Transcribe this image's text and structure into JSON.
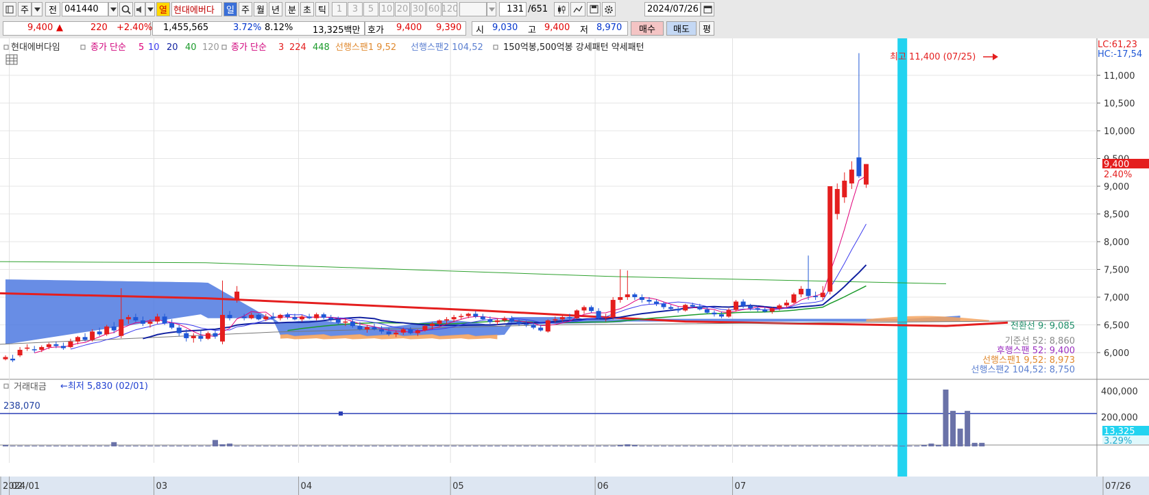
{
  "toolbar": {
    "market": "주",
    "prev_label": "전",
    "code": "041440",
    "sound_label": "열",
    "stock_name": "현대에버다",
    "periods": [
      "일",
      "주",
      "월",
      "년",
      "분",
      "초",
      "틱"
    ],
    "active_period": "일",
    "intervals": [
      "1",
      "3",
      "5",
      "10",
      "20",
      "30",
      "60",
      "120"
    ],
    "count": "131",
    "count_total": "/651",
    "date": "2024/07/26"
  },
  "quote": {
    "price": "9,400",
    "arrow": "▲",
    "change": "220",
    "change_pct": "+2.40%",
    "volume": "1,455,565",
    "turnover_pct": "3.72%",
    "rate2": "8.12%",
    "amount": "13,325백만",
    "hoga_label": "호가",
    "ask": "9,400",
    "bid": "9,390",
    "open_label": "시",
    "open": "9,030",
    "high_label": "고",
    "high": "9,400",
    "low_label": "저",
    "low": "8,970",
    "buy_label": "매수",
    "sell_label": "매도",
    "eval_label": "평"
  },
  "colors": {
    "up": "#e41e1e",
    "down": "#1f57d6",
    "ma5": "#e0007a",
    "ma10": "#3a3aee",
    "ma20": "#1020a0",
    "ma40": "#1a9a2a",
    "ma120": "#2ca02c",
    "ma3": "#e41e1e",
    "cloud_blue": "#4d79e0",
    "cloud_orange": "#f4a460",
    "highlight": "#22d3f0"
  },
  "legend": {
    "stock": "현대에버다임",
    "ma_label": "종가 단순",
    "ma_periods": [
      "5",
      "10",
      "20",
      "40",
      "120"
    ],
    "ma2_label": "종가 단순",
    "ma2_periods": [
      "3",
      "224",
      "448"
    ],
    "span1": "선행스팬1 9,52",
    "span2": "선행스팬2 104,52",
    "extra": "150억봉,500억봉 강세패턴  약세패턴"
  },
  "annotations": {
    "high": "최고 11,400 (07/25)",
    "low": "←최저 5,830 (02/01)",
    "lc": "LC:61,23",
    "hc": "HC:-17,54",
    "price_tag": "9,400",
    "pct_tag": "2.40%",
    "vol_tag": "13,325",
    "vol_pct_tag": "3.29%"
  },
  "ichimoku_labels": [
    {
      "text": "전환선 9: 9,085",
      "color": "#1f8f6a"
    },
    {
      "text": "기준선 52: 8,860",
      "color": "#8a8a8a"
    },
    {
      "text": "후행스팬 52: 9,400",
      "color": "#9b30c0"
    },
    {
      "text": "선행스팬1 9,52: 8,973",
      "color": "#e08a30"
    },
    {
      "text": "선행스팬2 104,52: 8,750",
      "color": "#5b7fd0"
    }
  ],
  "volume_panel": {
    "title": "거래대금",
    "ref_value": "238,070"
  },
  "chart_data": {
    "type": "candlestick",
    "title": "현대에버다임",
    "y_ticks": [
      6000,
      6500,
      7000,
      7500,
      8000,
      8500,
      9000,
      9500,
      10000,
      10500,
      11000
    ],
    "y_tick_labels": [
      "6,000",
      "6,500",
      "7,000",
      "7,500",
      "8,000",
      "8,500",
      "9,000",
      "9,500",
      "10,000",
      "10,500",
      "11,000"
    ],
    "ylim": [
      5550,
      11700
    ],
    "x_labels": [
      "2024/01",
      "02",
      "03",
      "04",
      "05",
      "06",
      "07",
      "07/26"
    ],
    "month_start_index": {
      "02": 1,
      "03": 21,
      "04": 41,
      "05": 62,
      "06": 82,
      "07": 101
    },
    "candles": [
      {
        "o": 5880,
        "h": 5950,
        "l": 5860,
        "c": 5920
      },
      {
        "o": 5890,
        "h": 5960,
        "l": 5830,
        "c": 5860
      },
      {
        "o": 5950,
        "h": 6100,
        "l": 5920,
        "c": 6050
      },
      {
        "o": 6070,
        "h": 6150,
        "l": 6030,
        "c": 6090
      },
      {
        "o": 6060,
        "h": 6120,
        "l": 6000,
        "c": 6050
      },
      {
        "o": 6050,
        "h": 6130,
        "l": 6010,
        "c": 6100
      },
      {
        "o": 6100,
        "h": 6180,
        "l": 6060,
        "c": 6150
      },
      {
        "o": 6150,
        "h": 6200,
        "l": 6080,
        "c": 6120
      },
      {
        "o": 6120,
        "h": 6180,
        "l": 6050,
        "c": 6080
      },
      {
        "o": 6100,
        "h": 6250,
        "l": 6080,
        "c": 6200
      },
      {
        "o": 6200,
        "h": 6300,
        "l": 6150,
        "c": 6280
      },
      {
        "o": 6280,
        "h": 6350,
        "l": 6200,
        "c": 6230
      },
      {
        "o": 6230,
        "h": 6420,
        "l": 6200,
        "c": 6380
      },
      {
        "o": 6380,
        "h": 6450,
        "l": 6300,
        "c": 6330
      },
      {
        "o": 6330,
        "h": 6500,
        "l": 6300,
        "c": 6470
      },
      {
        "o": 6470,
        "h": 6550,
        "l": 6350,
        "c": 6400
      },
      {
        "o": 6300,
        "h": 7160,
        "l": 6260,
        "c": 6600
      },
      {
        "o": 6600,
        "h": 6680,
        "l": 6520,
        "c": 6640
      },
      {
        "o": 6640,
        "h": 6700,
        "l": 6550,
        "c": 6580
      },
      {
        "o": 6580,
        "h": 6650,
        "l": 6480,
        "c": 6520
      },
      {
        "o": 6520,
        "h": 6600,
        "l": 6450,
        "c": 6560
      },
      {
        "o": 6560,
        "h": 6700,
        "l": 6520,
        "c": 6650
      },
      {
        "o": 6650,
        "h": 6700,
        "l": 6500,
        "c": 6530
      },
      {
        "o": 6530,
        "h": 6600,
        "l": 6420,
        "c": 6450
      },
      {
        "o": 6450,
        "h": 6500,
        "l": 6300,
        "c": 6350
      },
      {
        "o": 6350,
        "h": 6420,
        "l": 6200,
        "c": 6260
      },
      {
        "o": 6260,
        "h": 6350,
        "l": 6180,
        "c": 6300
      },
      {
        "o": 6300,
        "h": 6400,
        "l": 6200,
        "c": 6250
      },
      {
        "o": 6250,
        "h": 6380,
        "l": 6230,
        "c": 6350
      },
      {
        "o": 6350,
        "h": 6400,
        "l": 6250,
        "c": 6290
      },
      {
        "o": 6200,
        "h": 7300,
        "l": 6150,
        "c": 6680
      },
      {
        "o": 6680,
        "h": 6750,
        "l": 6580,
        "c": 6620
      },
      {
        "o": 6950,
        "h": 7200,
        "l": 6900,
        "c": 7100
      },
      {
        "o": 6650,
        "h": 6700,
        "l": 6580,
        "c": 6620
      },
      {
        "o": 6620,
        "h": 6720,
        "l": 6600,
        "c": 6680
      },
      {
        "o": 6680,
        "h": 6700,
        "l": 6580,
        "c": 6600
      },
      {
        "o": 6600,
        "h": 6700,
        "l": 6570,
        "c": 6650
      },
      {
        "o": 6650,
        "h": 6720,
        "l": 6600,
        "c": 6620
      },
      {
        "o": 6620,
        "h": 6700,
        "l": 6580,
        "c": 6680
      },
      {
        "o": 6680,
        "h": 6720,
        "l": 6600,
        "c": 6640
      },
      {
        "o": 6640,
        "h": 6700,
        "l": 6580,
        "c": 6600
      },
      {
        "o": 6600,
        "h": 6680,
        "l": 6560,
        "c": 6650
      },
      {
        "o": 6650,
        "h": 6700,
        "l": 6600,
        "c": 6620
      },
      {
        "o": 6620,
        "h": 6720,
        "l": 6580,
        "c": 6690
      },
      {
        "o": 6690,
        "h": 6720,
        "l": 6600,
        "c": 6630
      },
      {
        "o": 6630,
        "h": 6680,
        "l": 6560,
        "c": 6600
      },
      {
        "o": 6600,
        "h": 6650,
        "l": 6500,
        "c": 6540
      },
      {
        "o": 6540,
        "h": 6620,
        "l": 6480,
        "c": 6560
      },
      {
        "o": 6560,
        "h": 6600,
        "l": 6450,
        "c": 6480
      },
      {
        "o": 6480,
        "h": 6550,
        "l": 6400,
        "c": 6420
      },
      {
        "o": 6420,
        "h": 6500,
        "l": 6360,
        "c": 6460
      },
      {
        "o": 6460,
        "h": 6520,
        "l": 6400,
        "c": 6420
      },
      {
        "o": 6420,
        "h": 6480,
        "l": 6340,
        "c": 6380
      },
      {
        "o": 6380,
        "h": 6450,
        "l": 6300,
        "c": 6330
      },
      {
        "o": 6330,
        "h": 6400,
        "l": 6280,
        "c": 6360
      },
      {
        "o": 6360,
        "h": 6450,
        "l": 6320,
        "c": 6420
      },
      {
        "o": 6420,
        "h": 6460,
        "l": 6330,
        "c": 6350
      },
      {
        "o": 6350,
        "h": 6420,
        "l": 6300,
        "c": 6400
      },
      {
        "o": 6400,
        "h": 6500,
        "l": 6380,
        "c": 6480
      },
      {
        "o": 6480,
        "h": 6550,
        "l": 6420,
        "c": 6520
      },
      {
        "o": 6520,
        "h": 6600,
        "l": 6480,
        "c": 6580
      },
      {
        "o": 6580,
        "h": 6640,
        "l": 6520,
        "c": 6600
      },
      {
        "o": 6600,
        "h": 6680,
        "l": 6550,
        "c": 6640
      },
      {
        "o": 6640,
        "h": 6700,
        "l": 6600,
        "c": 6660
      },
      {
        "o": 6660,
        "h": 6720,
        "l": 6620,
        "c": 6700
      },
      {
        "o": 6700,
        "h": 6750,
        "l": 6620,
        "c": 6650
      },
      {
        "o": 6650,
        "h": 6700,
        "l": 6580,
        "c": 6600
      },
      {
        "o": 6600,
        "h": 6650,
        "l": 6520,
        "c": 6550
      },
      {
        "o": 6550,
        "h": 6620,
        "l": 6500,
        "c": 6580
      },
      {
        "o": 6580,
        "h": 6650,
        "l": 6550,
        "c": 6620
      },
      {
        "o": 6620,
        "h": 6660,
        "l": 6540,
        "c": 6560
      },
      {
        "o": 6560,
        "h": 6600,
        "l": 6480,
        "c": 6520
      },
      {
        "o": 6520,
        "h": 6580,
        "l": 6460,
        "c": 6500
      },
      {
        "o": 6500,
        "h": 6560,
        "l": 6420,
        "c": 6450
      },
      {
        "o": 6450,
        "h": 6500,
        "l": 6380,
        "c": 6400
      },
      {
        "o": 6380,
        "h": 6600,
        "l": 6360,
        "c": 6580
      },
      {
        "o": 6580,
        "h": 6650,
        "l": 6540,
        "c": 6600
      },
      {
        "o": 6600,
        "h": 6680,
        "l": 6560,
        "c": 6640
      },
      {
        "o": 6640,
        "h": 6700,
        "l": 6580,
        "c": 6620
      },
      {
        "o": 6620,
        "h": 6780,
        "l": 6600,
        "c": 6760
      },
      {
        "o": 6760,
        "h": 6850,
        "l": 6700,
        "c": 6820
      },
      {
        "o": 6820,
        "h": 6850,
        "l": 6720,
        "c": 6750
      },
      {
        "o": 6750,
        "h": 6800,
        "l": 6600,
        "c": 6620
      },
      {
        "o": 6620,
        "h": 6700,
        "l": 6560,
        "c": 6640
      },
      {
        "o": 6640,
        "h": 7000,
        "l": 6600,
        "c": 6950
      },
      {
        "o": 6950,
        "h": 7500,
        "l": 6900,
        "c": 7000
      },
      {
        "o": 7000,
        "h": 7480,
        "l": 6950,
        "c": 7050
      },
      {
        "o": 7050,
        "h": 7080,
        "l": 6950,
        "c": 7000
      },
      {
        "o": 7000,
        "h": 7050,
        "l": 6900,
        "c": 6950
      },
      {
        "o": 6950,
        "h": 7000,
        "l": 6880,
        "c": 6920
      },
      {
        "o": 6920,
        "h": 6960,
        "l": 6840,
        "c": 6880
      },
      {
        "o": 6880,
        "h": 6920,
        "l": 6780,
        "c": 6820
      },
      {
        "o": 6820,
        "h": 6860,
        "l": 6750,
        "c": 6790
      },
      {
        "o": 6790,
        "h": 6830,
        "l": 6720,
        "c": 6760
      },
      {
        "o": 6760,
        "h": 6880,
        "l": 6740,
        "c": 6860
      },
      {
        "o": 6860,
        "h": 6900,
        "l": 6800,
        "c": 6830
      },
      {
        "o": 6830,
        "h": 6880,
        "l": 6760,
        "c": 6780
      },
      {
        "o": 6780,
        "h": 6820,
        "l": 6700,
        "c": 6720
      },
      {
        "o": 6720,
        "h": 6760,
        "l": 6650,
        "c": 6690
      },
      {
        "o": 6690,
        "h": 6740,
        "l": 6620,
        "c": 6650
      },
      {
        "o": 6650,
        "h": 6800,
        "l": 6630,
        "c": 6770
      },
      {
        "o": 6770,
        "h": 6950,
        "l": 6740,
        "c": 6920
      },
      {
        "o": 6920,
        "h": 6960,
        "l": 6800,
        "c": 6840
      },
      {
        "o": 6840,
        "h": 6880,
        "l": 6760,
        "c": 6800
      },
      {
        "o": 6800,
        "h": 6850,
        "l": 6740,
        "c": 6780
      },
      {
        "o": 6780,
        "h": 6840,
        "l": 6720,
        "c": 6740
      },
      {
        "o": 6740,
        "h": 6820,
        "l": 6700,
        "c": 6800
      },
      {
        "o": 6800,
        "h": 6880,
        "l": 6760,
        "c": 6850
      },
      {
        "o": 6850,
        "h": 6950,
        "l": 6820,
        "c": 6900
      },
      {
        "o": 6900,
        "h": 7080,
        "l": 6880,
        "c": 7050
      },
      {
        "o": 7050,
        "h": 7200,
        "l": 7000,
        "c": 7150
      },
      {
        "o": 7150,
        "h": 7750,
        "l": 6950,
        "c": 7020
      },
      {
        "o": 7020,
        "h": 7100,
        "l": 6950,
        "c": 7000
      },
      {
        "o": 7000,
        "h": 7200,
        "l": 6950,
        "c": 7080
      },
      {
        "o": 7100,
        "h": 9000,
        "l": 7050,
        "c": 9000
      },
      {
        "o": 8500,
        "h": 9050,
        "l": 8400,
        "c": 8950
      },
      {
        "o": 8800,
        "h": 9250,
        "l": 8700,
        "c": 9100
      },
      {
        "o": 9050,
        "h": 9450,
        "l": 8950,
        "c": 9300
      },
      {
        "o": 9520,
        "h": 11400,
        "l": 9150,
        "c": 9180
      },
      {
        "o": 9030,
        "h": 9400,
        "l": 8970,
        "c": 9400
      }
    ],
    "volumes": [
      2,
      1,
      1,
      1,
      1,
      1,
      1,
      1,
      1,
      1,
      1,
      1,
      1,
      1,
      1,
      6,
      1,
      1,
      1,
      1,
      1,
      1,
      1,
      1,
      1,
      1,
      1,
      1,
      1,
      9,
      3,
      4,
      1,
      1,
      1,
      1,
      1,
      1,
      1,
      1,
      1,
      1,
      1,
      1,
      1,
      1,
      1,
      1,
      1,
      1,
      1,
      1,
      1,
      1,
      1,
      1,
      1,
      1,
      1,
      1,
      1,
      1,
      1,
      1,
      1,
      1,
      1,
      1,
      1,
      1,
      1,
      1,
      1,
      1,
      1,
      1,
      1,
      1,
      1,
      1,
      1,
      1,
      1,
      1,
      1,
      2,
      3,
      2,
      1,
      1,
      1,
      1,
      1,
      1,
      1,
      1,
      1,
      1,
      1,
      1,
      1,
      1,
      1,
      1,
      1,
      1,
      1,
      1,
      1,
      1,
      1,
      1,
      1,
      1,
      1,
      1,
      1,
      1,
      1,
      1,
      1,
      1,
      1,
      1,
      1,
      1,
      1,
      2,
      4,
      2,
      80,
      50,
      25,
      50,
      5,
      5
    ]
  }
}
